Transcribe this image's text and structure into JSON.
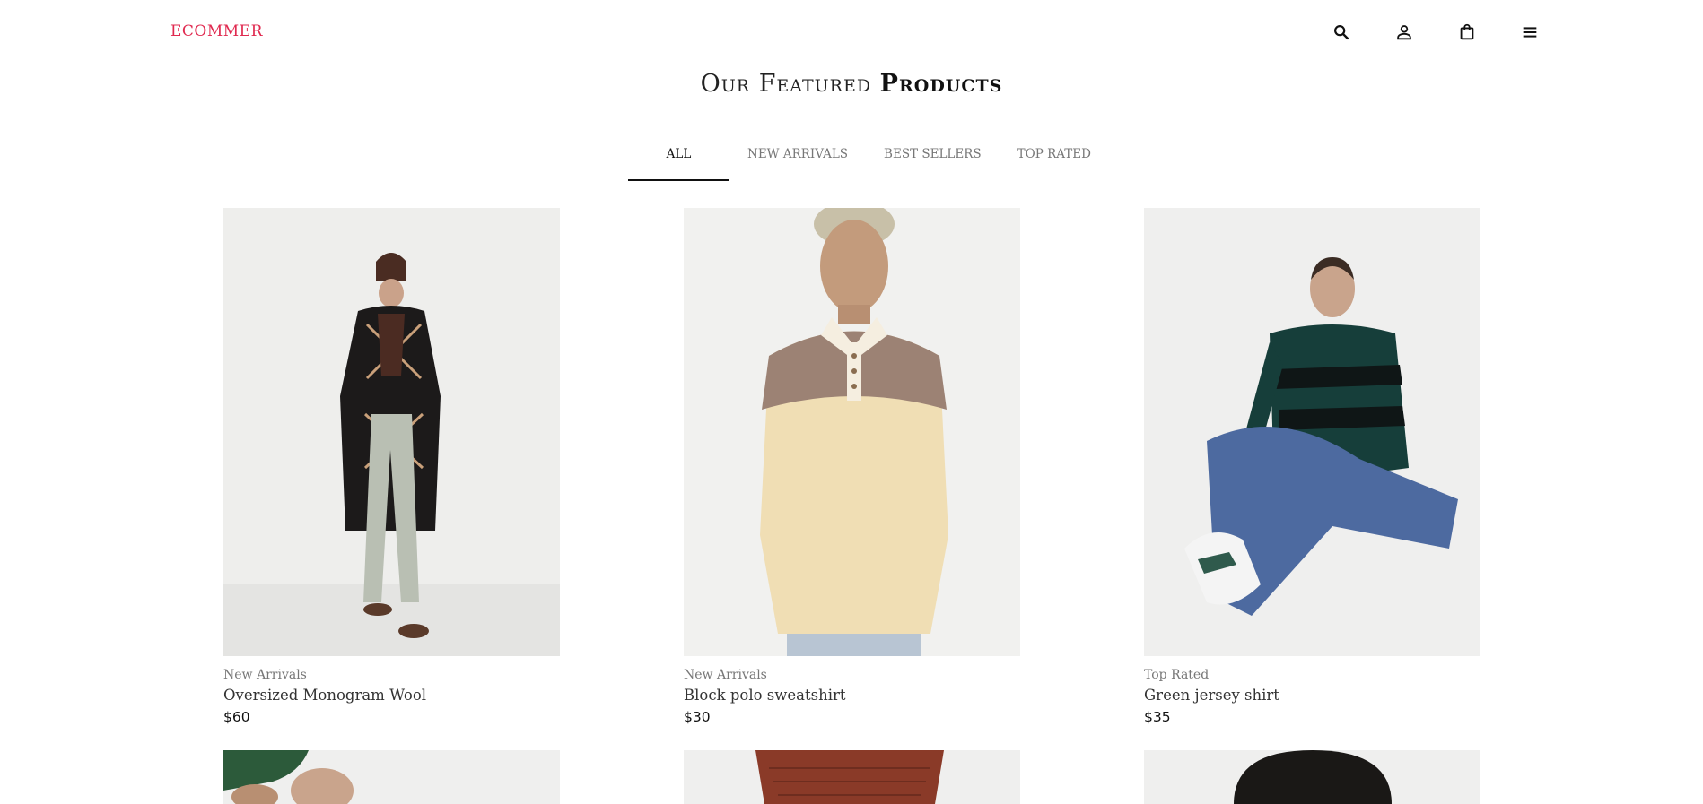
{
  "header": {
    "logo": "ECOMMER",
    "icons": [
      "search-icon",
      "user-icon",
      "shopping-bag-icon",
      "menu-icon"
    ]
  },
  "section": {
    "title_light": "Our Featured",
    "title_strong": "Products"
  },
  "tabs": [
    {
      "label": "ALL",
      "active": true
    },
    {
      "label": "NEW ARRIVALS",
      "active": false
    },
    {
      "label": "BEST SELLERS",
      "active": false
    },
    {
      "label": "TOP RATED",
      "active": false
    }
  ],
  "products": [
    {
      "category": "New Arrivals",
      "name": "Oversized Monogram Wool",
      "price": "$60"
    },
    {
      "category": "New Arrivals",
      "name": "Block polo sweatshirt",
      "price": "$30"
    },
    {
      "category": "Top Rated",
      "name": "Green jersey shirt",
      "price": "$35"
    }
  ],
  "colors": {
    "brand": "#e0294f",
    "text": "#111111",
    "muted": "#777777",
    "image_bg": "#ececec"
  }
}
